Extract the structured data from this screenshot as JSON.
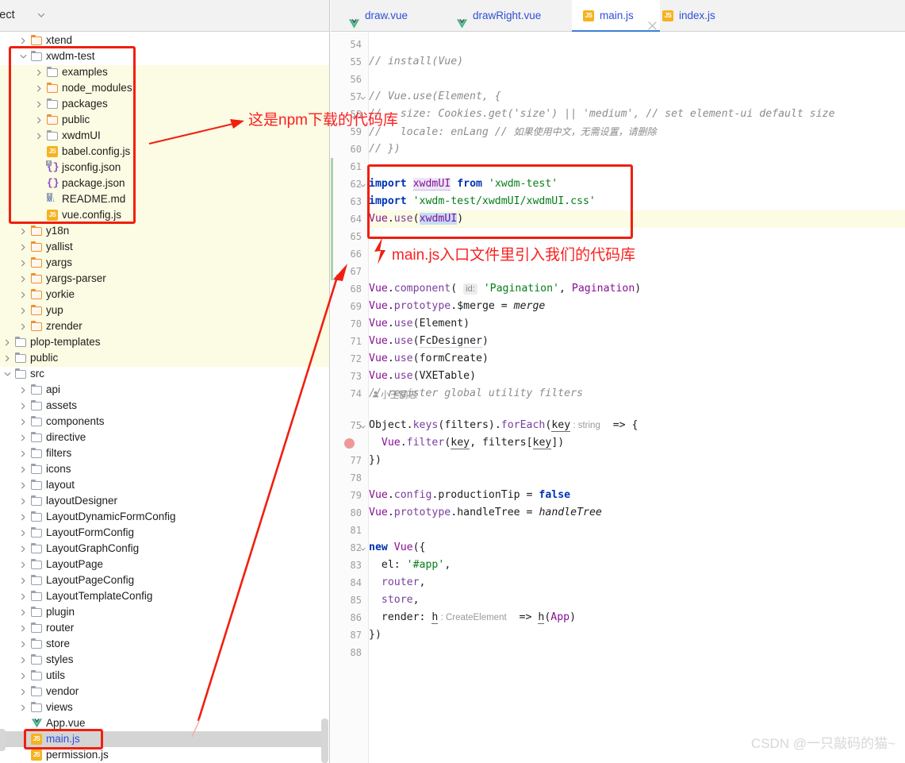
{
  "sidebar": {
    "header": {
      "title": "oject",
      "chevron_icon": "chevron-down-icon"
    },
    "tree": [
      {
        "label": "xtend",
        "type": "folder",
        "folder_color": "orange",
        "depth": 1,
        "arrow": "right",
        "highlight": true,
        "selected": false
      },
      {
        "label": "xwdm-test",
        "type": "folder",
        "folder_color": "gray",
        "depth": 1,
        "arrow": "down",
        "highlight": true,
        "selected": false
      },
      {
        "label": "examples",
        "type": "folder",
        "folder_color": "gray",
        "depth": 2,
        "arrow": "right",
        "highlight": true,
        "selected": false
      },
      {
        "label": "node_modules",
        "type": "folder",
        "folder_color": "orange",
        "depth": 2,
        "arrow": "right",
        "highlight": true,
        "selected": false
      },
      {
        "label": "packages",
        "type": "folder",
        "folder_color": "gray",
        "depth": 2,
        "arrow": "right",
        "highlight": true,
        "selected": false
      },
      {
        "label": "public",
        "type": "folder",
        "folder_color": "orange",
        "depth": 2,
        "arrow": "right",
        "highlight": true,
        "selected": false
      },
      {
        "label": "xwdmUI",
        "type": "folder",
        "folder_color": "gray",
        "depth": 2,
        "arrow": "right",
        "highlight": true,
        "selected": false
      },
      {
        "label": "babel.config.js",
        "type": "js",
        "depth": 2,
        "arrow": "none",
        "highlight": true,
        "selected": false
      },
      {
        "label": "jsconfig.json",
        "type": "jsonx",
        "depth": 2,
        "arrow": "none",
        "highlight": true,
        "selected": false
      },
      {
        "label": "package.json",
        "type": "json",
        "depth": 2,
        "arrow": "none",
        "highlight": true,
        "selected": false
      },
      {
        "label": "README.md",
        "type": "md",
        "depth": 2,
        "arrow": "none",
        "highlight": true,
        "selected": false
      },
      {
        "label": "vue.config.js",
        "type": "js",
        "depth": 2,
        "arrow": "none",
        "highlight": true,
        "selected": false
      },
      {
        "label": "y18n",
        "type": "folder",
        "folder_color": "orange",
        "depth": 1,
        "arrow": "right",
        "highlight": true,
        "selected": false
      },
      {
        "label": "yallist",
        "type": "folder",
        "folder_color": "orange",
        "depth": 1,
        "arrow": "right",
        "highlight": true,
        "selected": false
      },
      {
        "label": "yargs",
        "type": "folder",
        "folder_color": "orange",
        "depth": 1,
        "arrow": "right",
        "highlight": true,
        "selected": false
      },
      {
        "label": "yargs-parser",
        "type": "folder",
        "folder_color": "orange",
        "depth": 1,
        "arrow": "right",
        "highlight": true,
        "selected": false
      },
      {
        "label": "yorkie",
        "type": "folder",
        "folder_color": "orange",
        "depth": 1,
        "arrow": "right",
        "highlight": true,
        "selected": false
      },
      {
        "label": "yup",
        "type": "folder",
        "folder_color": "orange",
        "depth": 1,
        "arrow": "right",
        "highlight": true,
        "selected": false
      },
      {
        "label": "zrender",
        "type": "folder",
        "folder_color": "orange",
        "depth": 1,
        "arrow": "right",
        "highlight": true,
        "selected": false
      },
      {
        "label": "plop-templates",
        "type": "folder",
        "folder_color": "gray",
        "depth": 0,
        "arrow": "right",
        "highlight": false,
        "selected": false
      },
      {
        "label": "public",
        "type": "folder",
        "folder_color": "gray",
        "depth": 0,
        "arrow": "right",
        "highlight": false,
        "selected": false
      },
      {
        "label": "src",
        "type": "folder",
        "folder_color": "gray",
        "depth": 0,
        "arrow": "down",
        "highlight": false,
        "selected": false
      },
      {
        "label": "api",
        "type": "folder",
        "folder_color": "gray",
        "depth": 1,
        "arrow": "right",
        "highlight": false,
        "selected": false
      },
      {
        "label": "assets",
        "type": "folder",
        "folder_color": "gray",
        "depth": 1,
        "arrow": "right",
        "highlight": false,
        "selected": false
      },
      {
        "label": "components",
        "type": "folder",
        "folder_color": "gray",
        "depth": 1,
        "arrow": "right",
        "highlight": false,
        "selected": false
      },
      {
        "label": "directive",
        "type": "folder",
        "folder_color": "gray",
        "depth": 1,
        "arrow": "right",
        "highlight": false,
        "selected": false
      },
      {
        "label": "filters",
        "type": "folder",
        "folder_color": "gray",
        "depth": 1,
        "arrow": "right",
        "highlight": false,
        "selected": false
      },
      {
        "label": "icons",
        "type": "folder",
        "folder_color": "gray",
        "depth": 1,
        "arrow": "right",
        "highlight": false,
        "selected": false
      },
      {
        "label": "layout",
        "type": "folder",
        "folder_color": "gray",
        "depth": 1,
        "arrow": "right",
        "highlight": false,
        "selected": false
      },
      {
        "label": "layoutDesigner",
        "type": "folder",
        "folder_color": "gray",
        "depth": 1,
        "arrow": "right",
        "highlight": false,
        "selected": false
      },
      {
        "label": "LayoutDynamicFormConfig",
        "type": "folder",
        "folder_color": "gray",
        "depth": 1,
        "arrow": "right",
        "highlight": false,
        "selected": false
      },
      {
        "label": "LayoutFormConfig",
        "type": "folder",
        "folder_color": "gray",
        "depth": 1,
        "arrow": "right",
        "highlight": false,
        "selected": false
      },
      {
        "label": "LayoutGraphConfig",
        "type": "folder",
        "folder_color": "gray",
        "depth": 1,
        "arrow": "right",
        "highlight": false,
        "selected": false
      },
      {
        "label": "LayoutPage",
        "type": "folder",
        "folder_color": "gray",
        "depth": 1,
        "arrow": "right",
        "highlight": false,
        "selected": false
      },
      {
        "label": "LayoutPageConfig",
        "type": "folder",
        "folder_color": "gray",
        "depth": 1,
        "arrow": "right",
        "highlight": false,
        "selected": false
      },
      {
        "label": "LayoutTemplateConfig",
        "type": "folder",
        "folder_color": "gray",
        "depth": 1,
        "arrow": "right",
        "highlight": false,
        "selected": false
      },
      {
        "label": "plugin",
        "type": "folder",
        "folder_color": "gray",
        "depth": 1,
        "arrow": "right",
        "highlight": false,
        "selected": false
      },
      {
        "label": "router",
        "type": "folder",
        "folder_color": "gray",
        "depth": 1,
        "arrow": "right",
        "highlight": false,
        "selected": false
      },
      {
        "label": "store",
        "type": "folder",
        "folder_color": "gray",
        "depth": 1,
        "arrow": "right",
        "highlight": false,
        "selected": false
      },
      {
        "label": "styles",
        "type": "folder",
        "folder_color": "gray",
        "depth": 1,
        "arrow": "right",
        "highlight": false,
        "selected": false
      },
      {
        "label": "utils",
        "type": "folder",
        "folder_color": "gray",
        "depth": 1,
        "arrow": "right",
        "highlight": false,
        "selected": false
      },
      {
        "label": "vendor",
        "type": "folder",
        "folder_color": "gray",
        "depth": 1,
        "arrow": "right",
        "highlight": false,
        "selected": false
      },
      {
        "label": "views",
        "type": "folder",
        "folder_color": "gray",
        "depth": 1,
        "arrow": "right",
        "highlight": false,
        "selected": false
      },
      {
        "label": "App.vue",
        "type": "vue",
        "depth": 1,
        "arrow": "none",
        "highlight": false,
        "selected": false
      },
      {
        "label": "main.js",
        "type": "js",
        "depth": 1,
        "arrow": "none",
        "highlight": false,
        "selected": true
      },
      {
        "label": "permission.js",
        "type": "js",
        "depth": 1,
        "arrow": "none",
        "highlight": false,
        "selected": false
      }
    ]
  },
  "editor": {
    "tabs": [
      {
        "label": "draw.vue",
        "icon": "vue-file-icon",
        "active": false,
        "closable": false
      },
      {
        "label": "drawRight.vue",
        "icon": "vue-file-icon",
        "active": false,
        "closable": false
      },
      {
        "label": "main.js",
        "icon": "js-file-icon",
        "active": true,
        "closable": true
      },
      {
        "label": "index.js",
        "icon": "js-file-icon",
        "active": false,
        "closable": false
      }
    ],
    "inlay_author_hint": "小王同志",
    "lines": [
      {
        "num": "54",
        "fold": "",
        "text": ""
      },
      {
        "num": "55",
        "fold": "",
        "text": "// install(Vue)"
      },
      {
        "num": "56",
        "fold": "",
        "text": ""
      },
      {
        "num": "57",
        "fold": "down",
        "text": "// Vue.use(Element, {"
      },
      {
        "num": "58",
        "fold": "",
        "text": "//   size: Cookies.get('size') || 'medium', // set element-ui default size"
      },
      {
        "num": "59",
        "fold": "",
        "text": "//   locale: enLang // 如果使用中文，无需设置，请删除"
      },
      {
        "num": "60",
        "fold": "",
        "text": "// })"
      },
      {
        "num": "61",
        "fold": "",
        "text": ""
      },
      {
        "num": "62",
        "fold": "down",
        "text": "import xwdmUI from 'xwdm-test'"
      },
      {
        "num": "63",
        "fold": "",
        "text": "import 'xwdm-test/xwdmUI/xwdmUI.css'"
      },
      {
        "num": "64",
        "fold": "",
        "text": "Vue.use(xwdmUI)"
      },
      {
        "num": "65",
        "fold": "",
        "text": ""
      },
      {
        "num": "66",
        "fold": "",
        "text": ""
      },
      {
        "num": "67",
        "fold": "",
        "text": ""
      },
      {
        "num": "68",
        "fold": "",
        "text": "Vue.component( id: 'Pagination', Pagination)"
      },
      {
        "num": "69",
        "fold": "",
        "text": "Vue.prototype.$merge = merge"
      },
      {
        "num": "70",
        "fold": "",
        "text": "Vue.use(Element)"
      },
      {
        "num": "71",
        "fold": "",
        "text": "Vue.use(FcDesigner)"
      },
      {
        "num": "72",
        "fold": "",
        "text": "Vue.use(formCreate)"
      },
      {
        "num": "73",
        "fold": "",
        "text": "Vue.use(VXETable)"
      },
      {
        "num": "74",
        "fold": "",
        "text": "// register global utility filters"
      },
      {
        "num": "75",
        "fold": "down",
        "text": "Object.keys(filters).forEach(key : string  => {"
      },
      {
        "num": "76",
        "fold": "",
        "text": "  Vue.filter(key, filters[key])",
        "breakpoint": true
      },
      {
        "num": "77",
        "fold": "",
        "text": "})"
      },
      {
        "num": "78",
        "fold": "",
        "text": ""
      },
      {
        "num": "79",
        "fold": "",
        "text": "Vue.config.productionTip = false"
      },
      {
        "num": "80",
        "fold": "",
        "text": "Vue.prototype.handleTree = handleTree"
      },
      {
        "num": "81",
        "fold": "",
        "text": ""
      },
      {
        "num": "82",
        "fold": "down",
        "text": "new Vue({"
      },
      {
        "num": "83",
        "fold": "",
        "text": "  el: '#app',"
      },
      {
        "num": "84",
        "fold": "",
        "text": "  router,"
      },
      {
        "num": "85",
        "fold": "",
        "text": "  store,"
      },
      {
        "num": "86",
        "fold": "",
        "text": "  render: h : CreateElement  => h(App)"
      },
      {
        "num": "87",
        "fold": "",
        "text": "})"
      },
      {
        "num": "88",
        "fold": "",
        "text": ""
      }
    ]
  },
  "annotations": {
    "note_npm": "这是npm下载的代码库",
    "note_mainjs": "main.js入口文件里引入我们的代码库",
    "accent_color": "#fa2020"
  },
  "watermark": "CSDN @一只敲码的猫~"
}
